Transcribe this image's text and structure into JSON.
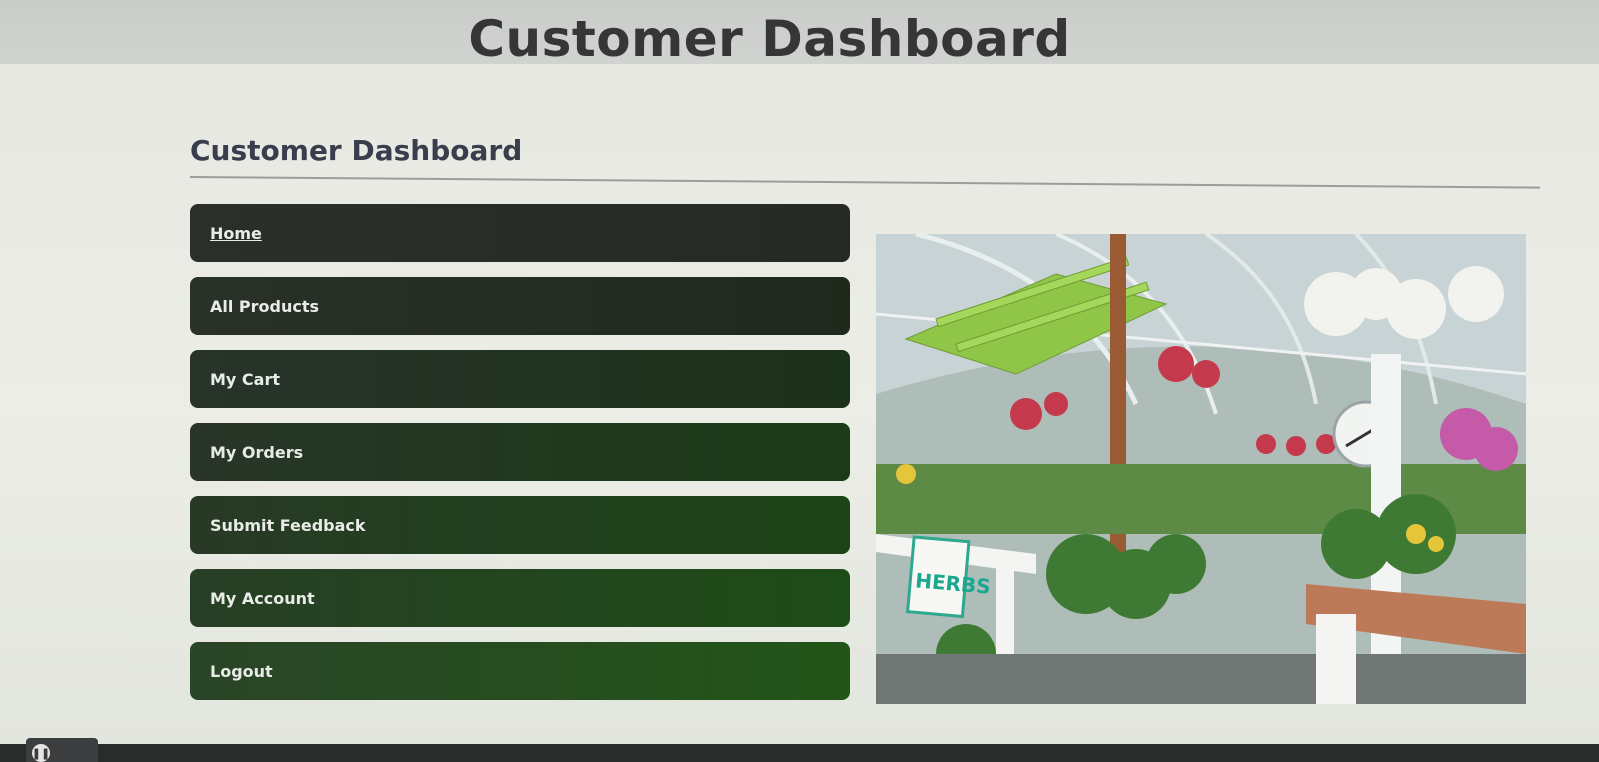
{
  "header": {
    "title": "Customer Dashboard"
  },
  "main": {
    "heading": "Customer Dashboard",
    "nav": [
      {
        "label": "Home"
      },
      {
        "label": "All Products"
      },
      {
        "label": "My Cart"
      },
      {
        "label": "My Orders"
      },
      {
        "label": "Submit Feedback"
      },
      {
        "label": "My Account"
      },
      {
        "label": "Logout"
      }
    ],
    "hero_image": {
      "sign_text": "HERBS"
    }
  },
  "player": {
    "pause_icon": "pause-icon"
  }
}
